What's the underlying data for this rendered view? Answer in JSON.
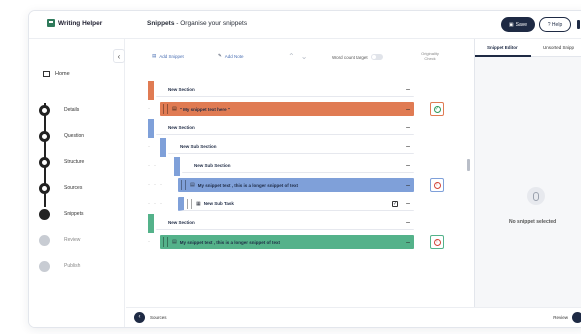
{
  "app": {
    "name": "Writing Helper",
    "page_title": "Snippets",
    "page_subtitle": "- Organise your snippets"
  },
  "header": {
    "save_label": "Save",
    "help_label": "? Help"
  },
  "sidebar": {
    "home_label": "Home",
    "steps": [
      {
        "label": "Details",
        "state": "done"
      },
      {
        "label": "Question",
        "state": "done"
      },
      {
        "label": "Structure",
        "state": "done"
      },
      {
        "label": "Sources",
        "state": "done"
      },
      {
        "label": "Snippets",
        "state": "current"
      },
      {
        "label": "Review",
        "state": "upcoming"
      },
      {
        "label": "Publish",
        "state": "upcoming"
      }
    ]
  },
  "toolbar": {
    "add_snippet": "Add Snippet",
    "add_note": "Add Note",
    "word_count_target": "Word count target",
    "originality_check": "Originality Check"
  },
  "rows": [
    {
      "kind": "section",
      "text": "New Section",
      "level": 0,
      "color": "#e07b53"
    },
    {
      "kind": "snippet",
      "text": "\" My snippet text here \"",
      "level": 0,
      "color": "#e07b53",
      "check": "ok"
    },
    {
      "kind": "section",
      "text": "New Section",
      "level": 0,
      "color": "#7fa0d9"
    },
    {
      "kind": "section",
      "text": "New Sub Section",
      "level": 1,
      "color": "#7fa0d9"
    },
    {
      "kind": "section",
      "text": "New Sub Section",
      "level": 2,
      "color": "#7fa0d9"
    },
    {
      "kind": "snippet",
      "text": "My snippet text , this is a longer snippet of text",
      "level": 2,
      "color": "#7fa0d9",
      "check": "warn"
    },
    {
      "kind": "task",
      "text": "New Sub Task",
      "level": 2,
      "color": "#7fa0d9"
    },
    {
      "kind": "section",
      "text": "New Section",
      "level": 0,
      "color": "#54b28a"
    },
    {
      "kind": "snippet",
      "text": "My snippet text , this is a longer snippet of text",
      "level": 0,
      "color": "#54b28a",
      "check": "warn"
    }
  ],
  "right_panel": {
    "tabs": [
      "Snippet Editor",
      "Unsorted Snipp"
    ],
    "empty_message": "No snippet selected"
  },
  "footer": {
    "prev_label": "Sources",
    "next_label": "Review"
  }
}
